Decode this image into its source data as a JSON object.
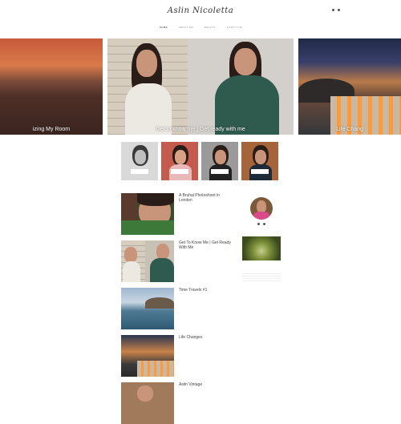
{
  "header": {
    "logo": "Aslin Nicoletta",
    "nav": [
      "HOME",
      "ABOUT ME",
      "BEAUTY",
      "LIFESTYLE"
    ]
  },
  "slider": [
    {
      "tag": "",
      "caption": "izing My Room"
    },
    {
      "tag": "",
      "caption": "Get to know me | Get ready with me"
    },
    {
      "tag": "",
      "caption": "Life Chang"
    }
  ],
  "thumbs": [
    {
      "label": ""
    },
    {
      "label": ""
    },
    {
      "label": ""
    },
    {
      "label": ""
    }
  ],
  "posts": [
    {
      "title": "A Bruhal Photoshoot in London",
      "meta": "",
      "excerpt": ""
    },
    {
      "title": "Get To Know Me | Get Ready With Me",
      "meta": "",
      "excerpt": ""
    },
    {
      "title": "Time Travels #1",
      "meta": "",
      "excerpt": ""
    },
    {
      "title": "Life Changes",
      "meta": "",
      "excerpt": ""
    },
    {
      "title": "Aslin Vintage",
      "meta": "",
      "excerpt": ""
    }
  ],
  "sidebar": {
    "about_heading": "",
    "about_text": "",
    "instagram_heading": "",
    "instagram_text": "",
    "categories_heading": "",
    "categories": [
      {
        "label": "",
        "count": ""
      },
      {
        "label": "",
        "count": ""
      },
      {
        "label": "",
        "count": ""
      },
      {
        "label": "",
        "count": ""
      }
    ]
  },
  "colors": {
    "accent": "#333333",
    "muted": "#999999"
  }
}
